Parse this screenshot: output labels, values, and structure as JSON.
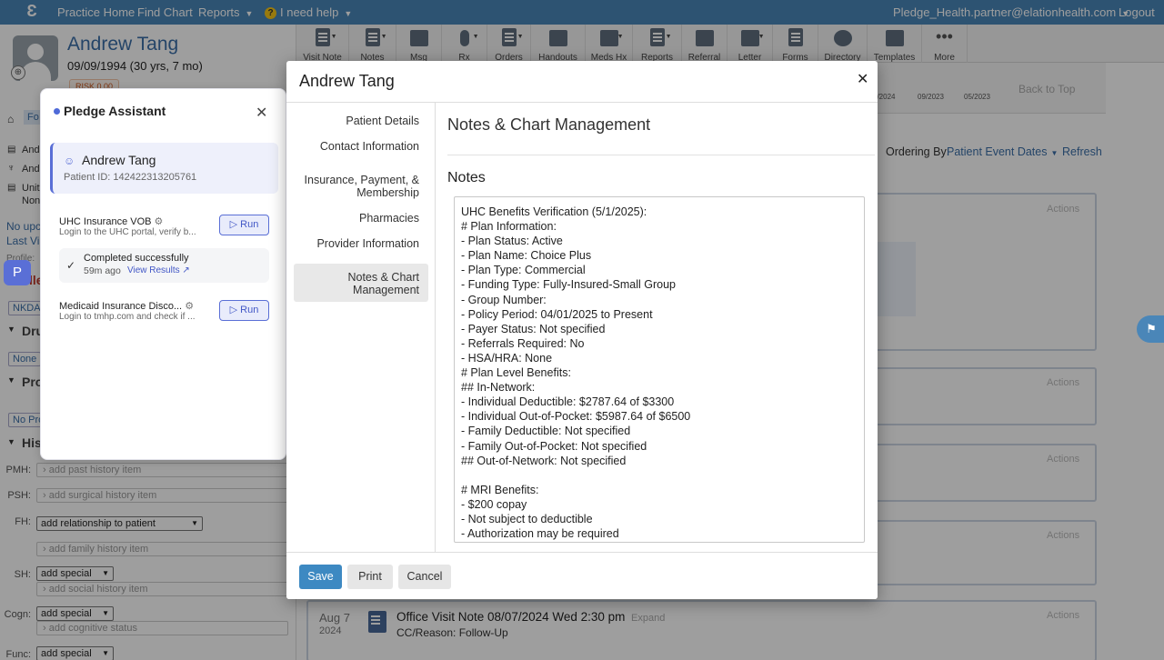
{
  "topnav": {
    "links": [
      "Practice Home",
      "Find Chart",
      "Reports",
      "I need help"
    ],
    "user": "Pledge_Health.partner@elationhealth.com",
    "logout": "Logout"
  },
  "toolbar": {
    "items": [
      "Visit Note",
      "Notes",
      "Msg",
      "Rx",
      "Orders",
      "Handouts",
      "Meds Hx",
      "Reports",
      "Referral",
      "Letter",
      "Forms",
      "Directory",
      "Templates",
      "More"
    ]
  },
  "patient": {
    "name": "Andrew Tang",
    "dob": "09/09/1994 (30 yrs, 7 mo)",
    "risk": "RISK 0.00"
  },
  "left": {
    "tag": "Fo",
    "row1": "Andr",
    "row2": "Andr",
    "row3": "Unite",
    "row3b": "Non",
    "upcoming": "No upco",
    "lastvisit": "Last Visi",
    "profile": "Profile:",
    "allergies_frag": "lle",
    "nkda": "NKDA",
    "drug": "Dru",
    "none": "None",
    "prob": "Pro",
    "noprob": "No Pro",
    "hist": "Hist",
    "hist_rows": [
      {
        "label": "PMH:",
        "placeholder": "add past history item"
      },
      {
        "label": "PSH:",
        "placeholder": "add surgical history item"
      },
      {
        "label": "FH:",
        "select": "add relationship to patient",
        "placeholder": "add family history item"
      },
      {
        "label": "SH:",
        "select": "add special",
        "placeholder": "add social history item"
      },
      {
        "label": "Cogn:",
        "select": "add special",
        "placeholder": "add cognitive status"
      },
      {
        "label": "Func:",
        "select": "add special"
      }
    ]
  },
  "right": {
    "timeline": [
      "2/2024",
      "09/2023",
      "05/2023"
    ],
    "back_to_top": "Back to Top",
    "ordering_label": "Ordering By:",
    "ordering_value": "Patient Event Dates",
    "refresh": "Refresh",
    "actions": "Actions",
    "visit": {
      "month_day": "Aug 7",
      "year": "2024",
      "title": "Office Visit Note 08/07/2024 Wed 2:30 pm",
      "expand": "Expand",
      "reason": "CC/Reason: Follow-Up"
    }
  },
  "assistant": {
    "title": "Pledge Assistant",
    "patient_name": "Andrew Tang",
    "patient_id": "Patient ID: 142422313205761",
    "tasks": [
      {
        "name": "UHC Insurance VOB",
        "desc": "Login to the UHC portal, verify b...",
        "run": "Run"
      },
      {
        "name": "Medicaid Insurance Disco...",
        "desc": "Login to tmhp.com and check if ...",
        "run": "Run"
      }
    ],
    "status": "Completed successfully",
    "ago": "59m ago",
    "view": "View Results",
    "badge": "P"
  },
  "modal": {
    "title": "Andrew Tang",
    "nav": [
      "Patient Details",
      "Contact Information",
      "Insurance, Payment, &",
      "Membership",
      "Pharmacies",
      "Provider Information",
      "Notes & Chart",
      "Management"
    ],
    "heading": "Notes & Chart Management",
    "notes_label": "Notes",
    "notes_lines": [
      "UHC Benefits Verification (5/1/2025):",
      "# Plan Information:",
      "- Plan Status: Active",
      "- Plan Name: Choice Plus",
      "- Plan Type: Commercial",
      "- Funding Type: Fully-Insured-Small Group",
      "- Group Number:",
      "- Policy Period: 04/01/2025 to Present",
      "- Payer Status: Not specified",
      "- Referrals Required: No",
      "- HSA/HRA: None",
      "# Plan Level Benefits:",
      "## In-Network:",
      "- Individual Deductible: $2787.64 of $3300",
      "- Individual Out-of-Pocket: $5987.64 of $6500",
      "- Family Deductible: Not specified",
      "- Family Out-of-Pocket: Not specified",
      "## Out-of-Network: Not specified",
      "",
      "# MRI Benefits:",
      "- $200 copay",
      "- Not subject to deductible",
      "- Authorization may be required"
    ],
    "save": "Save",
    "print": "Print",
    "cancel": "Cancel"
  },
  "colors": {
    "nav": "#4a86b8",
    "link": "#3a6fa8",
    "assistant_accent": "#5a6fd6"
  }
}
